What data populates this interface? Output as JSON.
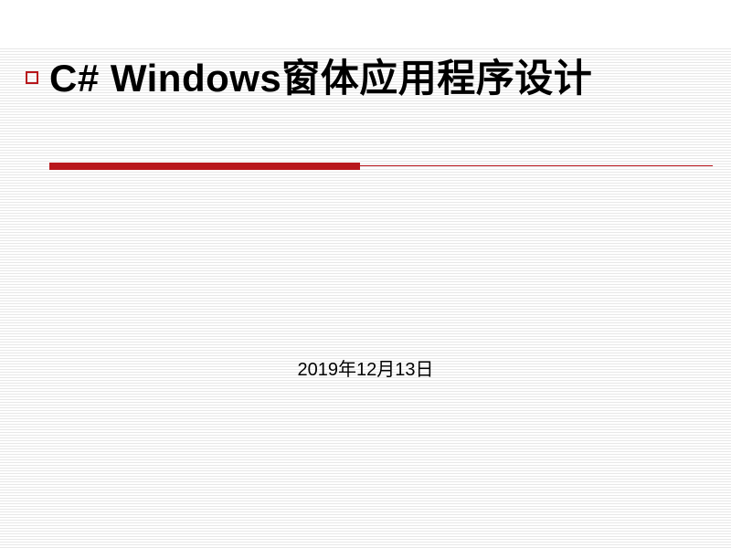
{
  "slide": {
    "title": "C# Windows窗体应用程序设计",
    "date": "2019年12月13日"
  }
}
